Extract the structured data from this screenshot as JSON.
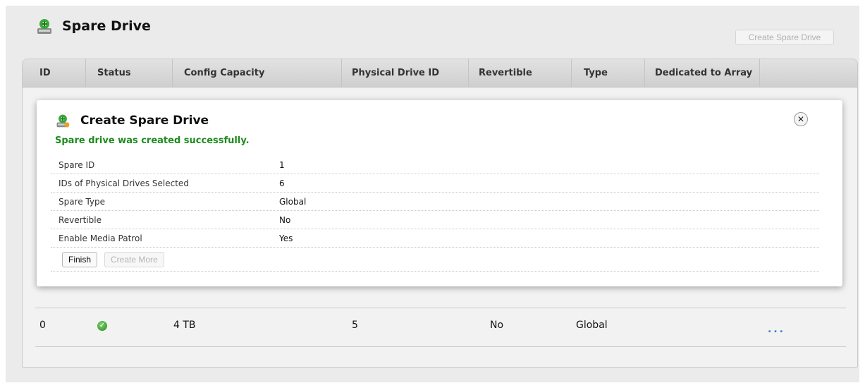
{
  "header": {
    "title": "Spare Drive",
    "icon": "spare-drive-icon",
    "create_button_label": "Create Spare Drive"
  },
  "table": {
    "columns": [
      "ID",
      "Status",
      "Config Capacity",
      "Physical Drive ID",
      "Revertible",
      "Type",
      "Dedicated to Array"
    ],
    "rows": [
      {
        "id": "0",
        "status_icon": "ok-check-icon",
        "config_capacity": "4 TB",
        "physical_drive_id": "5",
        "revertible": "No",
        "type": "Global",
        "dedicated_to_array": "",
        "more": "..."
      }
    ]
  },
  "modal": {
    "title": "Create Spare Drive",
    "icon": "spare-drive-icon",
    "success_message": "Spare drive was created successfully.",
    "details": [
      {
        "label": "Spare ID",
        "value": "1"
      },
      {
        "label": "IDs of Physical Drives Selected",
        "value": "6"
      },
      {
        "label": "Spare Type",
        "value": "Global"
      },
      {
        "label": "Revertible",
        "value": "No"
      },
      {
        "label": "Enable Media Patrol",
        "value": "Yes"
      }
    ],
    "finish_label": "Finish",
    "create_more_label": "Create More",
    "close_icon": "close-icon"
  },
  "colors": {
    "success_text": "#1e8a1e",
    "link_blue": "#3a7bd5",
    "status_ok": "#2b8a25"
  }
}
